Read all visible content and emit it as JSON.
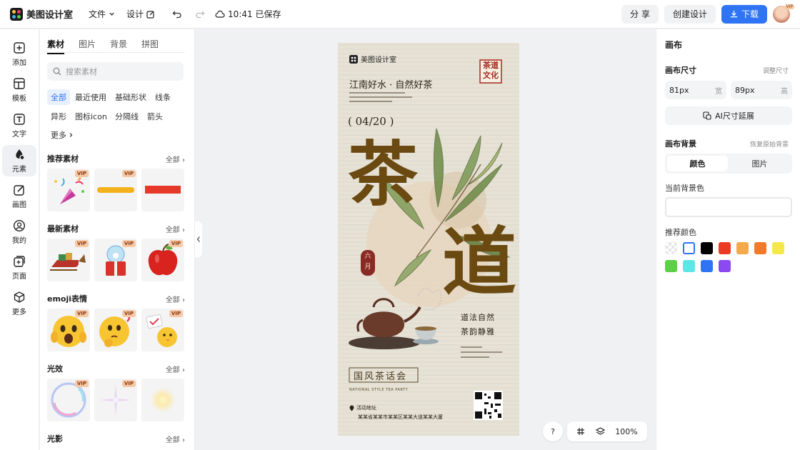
{
  "topbar": {
    "app_name": "美图设计室",
    "file_menu": "文件",
    "design_menu": "设计",
    "save_status": "10:41 已保存",
    "share_label": "分 享",
    "create_label": "创建设计",
    "download_label": "下载",
    "avatar_badge": "VIP"
  },
  "leftnav": [
    {
      "label": "添加",
      "icon": "plus-square-icon"
    },
    {
      "label": "模板",
      "icon": "template-icon"
    },
    {
      "label": "文字",
      "icon": "text-icon"
    },
    {
      "label": "元素",
      "icon": "shapes-icon"
    },
    {
      "label": "画图",
      "icon": "draw-icon"
    },
    {
      "label": "我的",
      "icon": "user-icon"
    },
    {
      "label": "页面",
      "icon": "page-add-icon"
    },
    {
      "label": "更多",
      "icon": "cube-icon"
    }
  ],
  "panel": {
    "tabs": [
      "素材",
      "图片",
      "背景",
      "拼图"
    ],
    "search_placeholder": "搜索素材",
    "chips": [
      "全部",
      "最近使用",
      "基础形状",
      "线条",
      "异形",
      "图标icon",
      "分隔线",
      "箭头",
      "更多"
    ],
    "sections": [
      {
        "title": "推荐素材",
        "all": "全部"
      },
      {
        "title": "最新素材",
        "all": "全部"
      },
      {
        "title": "emoji表情",
        "all": "全部"
      },
      {
        "title": "光效",
        "all": "全部"
      },
      {
        "title": "光影",
        "all": "全部"
      }
    ],
    "vip": "VIP"
  },
  "poster": {
    "brand": "美图设计室",
    "headline": "江南好水 · 自然好茶",
    "date": "( 04/20 )",
    "seal": "茶道文化",
    "big1": "茶",
    "big2": "道",
    "red_seal": "六月",
    "slogan1": "道法自然",
    "slogan2": "茶韵静雅",
    "title_box": "国风茶话会",
    "subtitle_en": "NATIONAL STYLE TEA PARTY",
    "address_label": "活动地址",
    "address": "某某省某某市某某区某某大道某某大厦"
  },
  "bottombar": {
    "help": "?",
    "zoom": "100%"
  },
  "right": {
    "title": "画布",
    "size_label": "画布尺寸",
    "adjust_size": "调整尺寸",
    "width_value": "81px",
    "width_unit": "宽",
    "height_value": "89px",
    "height_unit": "高",
    "ai_extend": "AI尺寸延展",
    "bg_label": "画布背景",
    "restore_bg": "恢复原始背景",
    "bg_tabs": [
      "颜色",
      "图片"
    ],
    "current_bg": "当前背景色",
    "recommend": "推荐颜色",
    "swatches": [
      "transparent",
      "#ffffff",
      "#000000",
      "#ec3b24",
      "#f5a94a",
      "#ef7a2a",
      "#f5e94a",
      "#5cd046",
      "#5de6e6",
      "#2f74f5",
      "#8a4af0"
    ]
  }
}
